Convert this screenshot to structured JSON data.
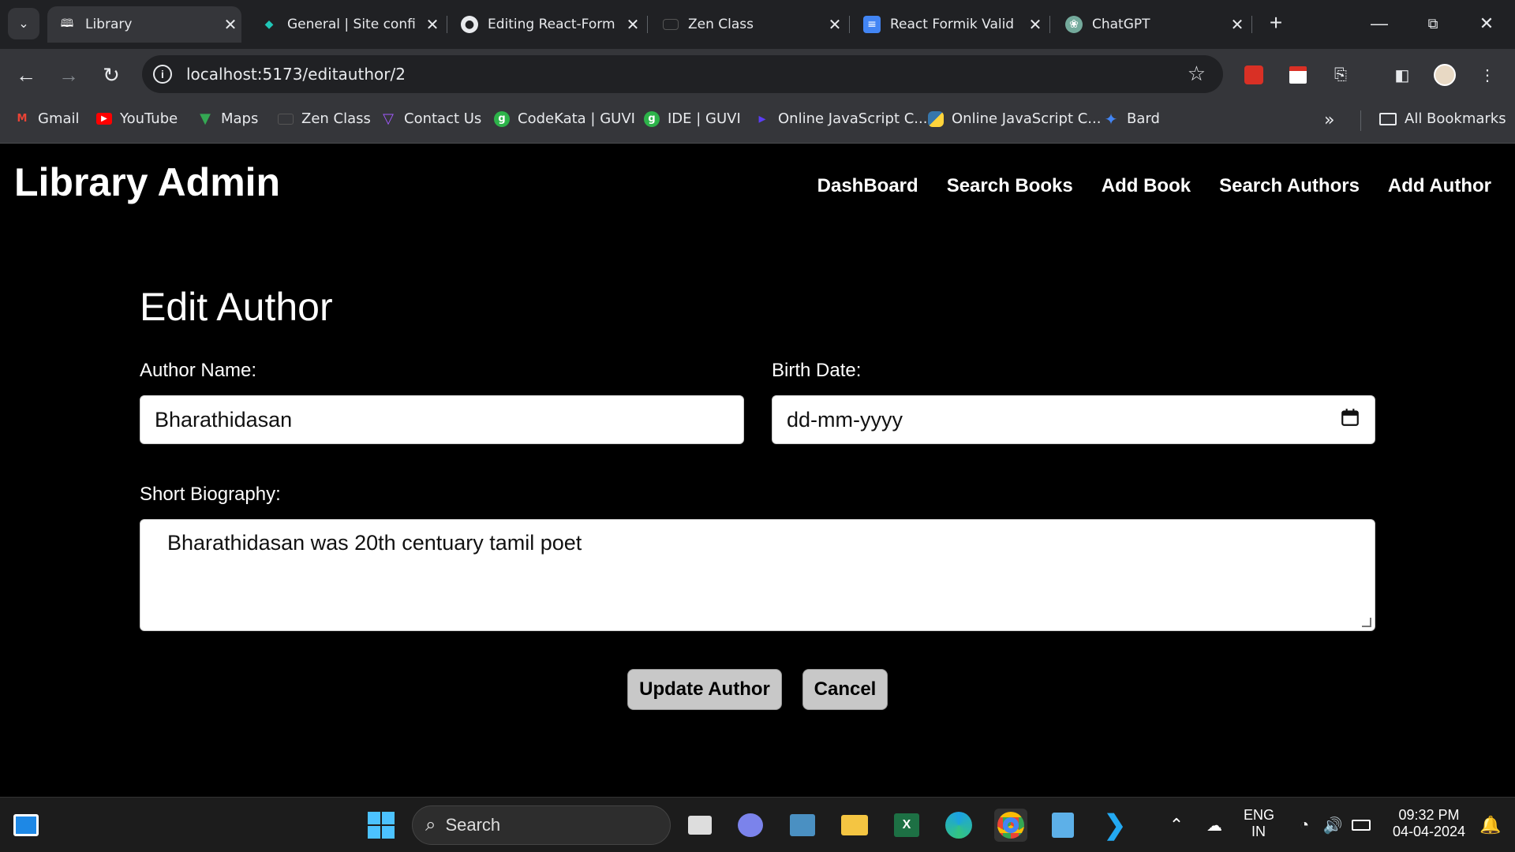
{
  "browser": {
    "tabs": [
      {
        "title": "Library",
        "active": true,
        "favicon": "book-icon"
      },
      {
        "title": "General | Site confi",
        "favicon": "netlify-icon"
      },
      {
        "title": "Editing React-Form",
        "favicon": "github-icon"
      },
      {
        "title": "Zen Class",
        "favicon": "zen-icon"
      },
      {
        "title": "React Formik Valid",
        "favicon": "docs-icon"
      },
      {
        "title": "ChatGPT",
        "favicon": "chatgpt-icon"
      }
    ],
    "url": "localhost:5173/editauthor/2",
    "bookmarks": [
      {
        "label": "Gmail",
        "icon": "gmail-icon",
        "color": "#ea4335"
      },
      {
        "label": "YouTube",
        "icon": "youtube-icon",
        "color": "#ff0000"
      },
      {
        "label": "Maps",
        "icon": "maps-icon",
        "color": "#34a853"
      },
      {
        "label": "Zen Class",
        "icon": "zen-icon",
        "color": "#444444"
      },
      {
        "label": "Contact Us",
        "icon": "vite-icon",
        "color": "#a259ff"
      },
      {
        "label": "CodeKata | GUVI",
        "icon": "guvi-icon",
        "color": "#2db34a"
      },
      {
        "label": "IDE | GUVI",
        "icon": "guvi-icon",
        "color": "#2db34a"
      },
      {
        "label": "Online JavaScript C...",
        "icon": "programiz-icon",
        "color": "#5b3df5"
      },
      {
        "label": "Online JavaScript C...",
        "icon": "python-icon",
        "color": "#3776ab"
      },
      {
        "label": "Bard",
        "icon": "bard-icon",
        "color": "#4285f4"
      }
    ],
    "all_bookmarks": "All Bookmarks"
  },
  "app": {
    "brand": "Library Admin",
    "nav": [
      "DashBoard",
      "Search Books",
      "Add Book",
      "Search Authors",
      "Add Author"
    ]
  },
  "form": {
    "title": "Edit Author",
    "author_name_label": "Author Name:",
    "author_name_value": "Bharathidasan",
    "birth_date_label": "Birth Date:",
    "birth_date_placeholder": "dd-mm-yyyy",
    "bio_label": "Short Biography:",
    "bio_value": "Bharathidasan was 20th centuary tamil poet",
    "update_button": "Update Author",
    "cancel_button": "Cancel"
  },
  "taskbar": {
    "search": "Search",
    "lang": "ENG",
    "region": "IN",
    "time": "09:32 PM",
    "date": "04-04-2024"
  }
}
